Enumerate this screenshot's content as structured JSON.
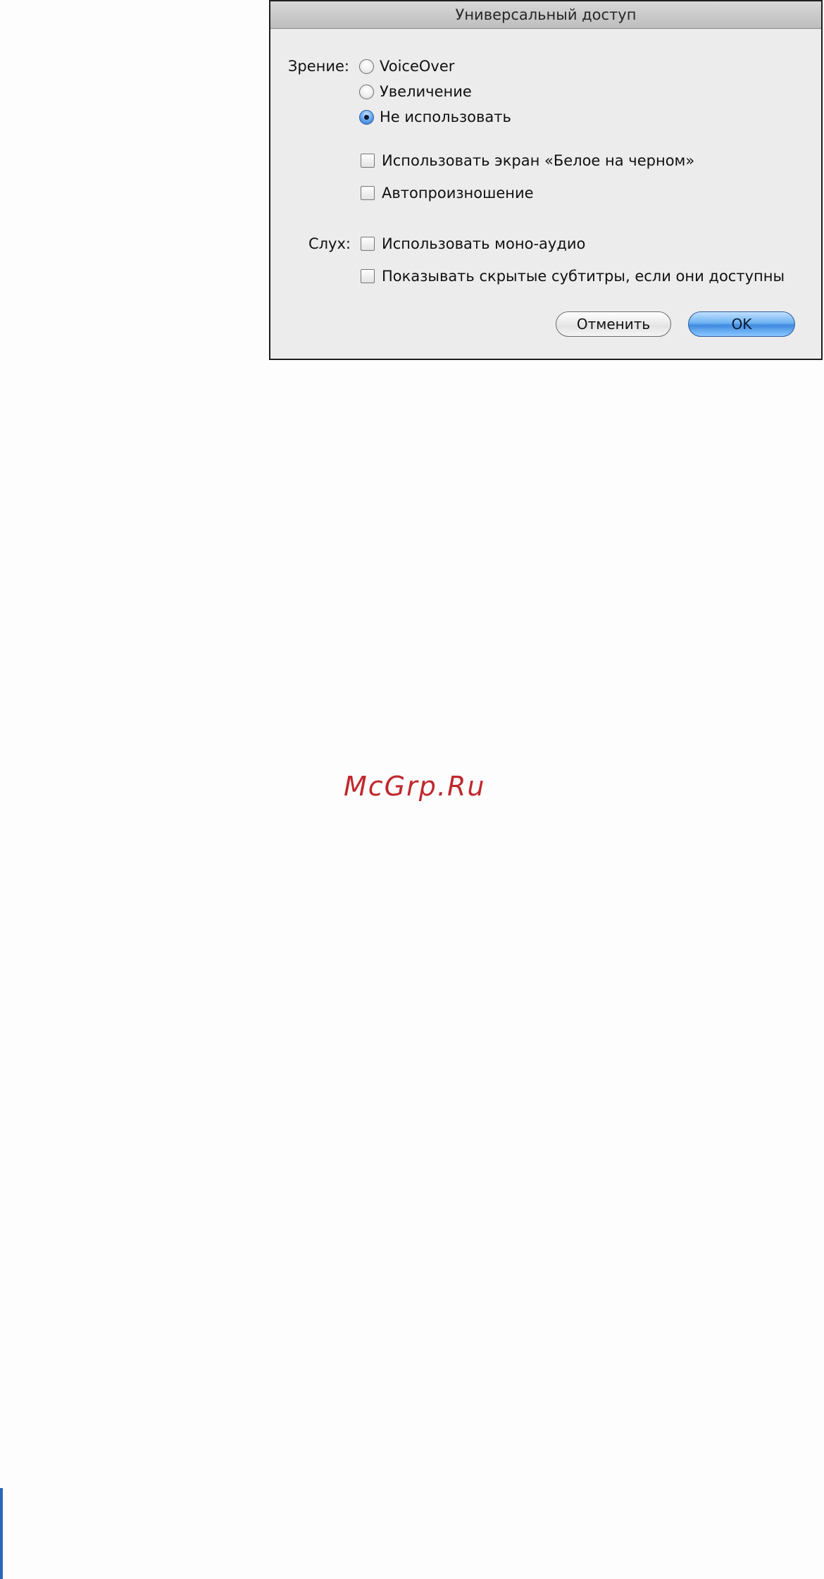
{
  "dialog": {
    "title": "Универсальный доступ",
    "vision": {
      "label": "Зрение:",
      "options": [
        {
          "label": "VoiceOver",
          "selected": false
        },
        {
          "label": "Увеличение",
          "selected": false
        },
        {
          "label": "Не использовать",
          "selected": true
        }
      ],
      "checkboxes": [
        {
          "label": "Использовать экран «Белое на черном»",
          "checked": false
        },
        {
          "label": "Автопроизношение",
          "checked": false
        }
      ]
    },
    "hearing": {
      "label": "Слух:",
      "checkboxes": [
        {
          "label": "Использовать моно-аудио",
          "checked": false
        },
        {
          "label": "Показывать скрытые субтитры, если они доступны",
          "checked": false
        }
      ]
    },
    "buttons": {
      "cancel": "Отменить",
      "ok": "OK"
    }
  },
  "watermark": "McGrp.Ru",
  "colors": {
    "accent": "#3e8be0",
    "watermark": "#c0282d",
    "left_bar": "#2a66b8"
  }
}
